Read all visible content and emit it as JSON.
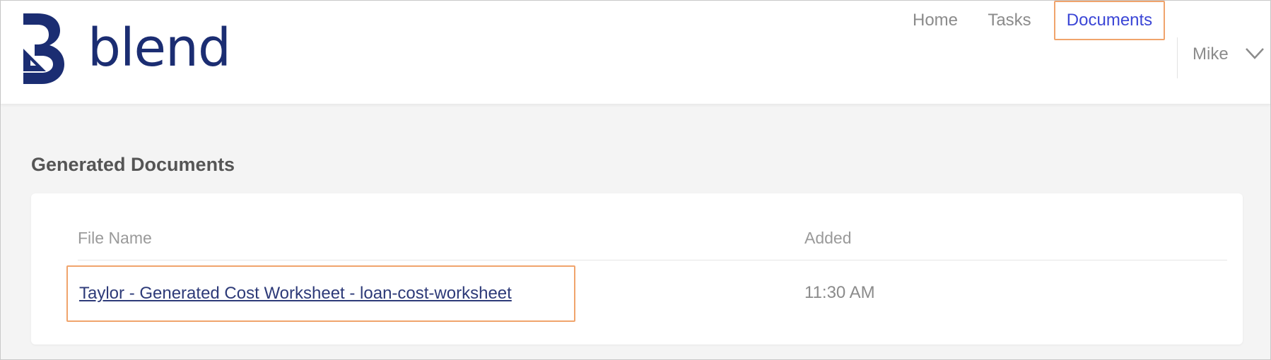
{
  "brand": {
    "name": "blend",
    "color": "#1b2d72"
  },
  "nav": {
    "items": [
      {
        "label": "Home"
      },
      {
        "label": "Tasks"
      },
      {
        "label": "Documents",
        "active": true
      }
    ],
    "active_color": "#3b46d6",
    "highlight_color": "#f0a46c",
    "user": {
      "name": "Mike",
      "icon": "chevron-down-icon"
    }
  },
  "main": {
    "section_title": "Generated Documents",
    "table": {
      "columns": [
        "File Name",
        "Added"
      ],
      "rows": [
        {
          "file_name": "Taylor - Generated Cost Worksheet - loan-cost-worksheet",
          "added": "11:30 AM"
        }
      ]
    }
  }
}
